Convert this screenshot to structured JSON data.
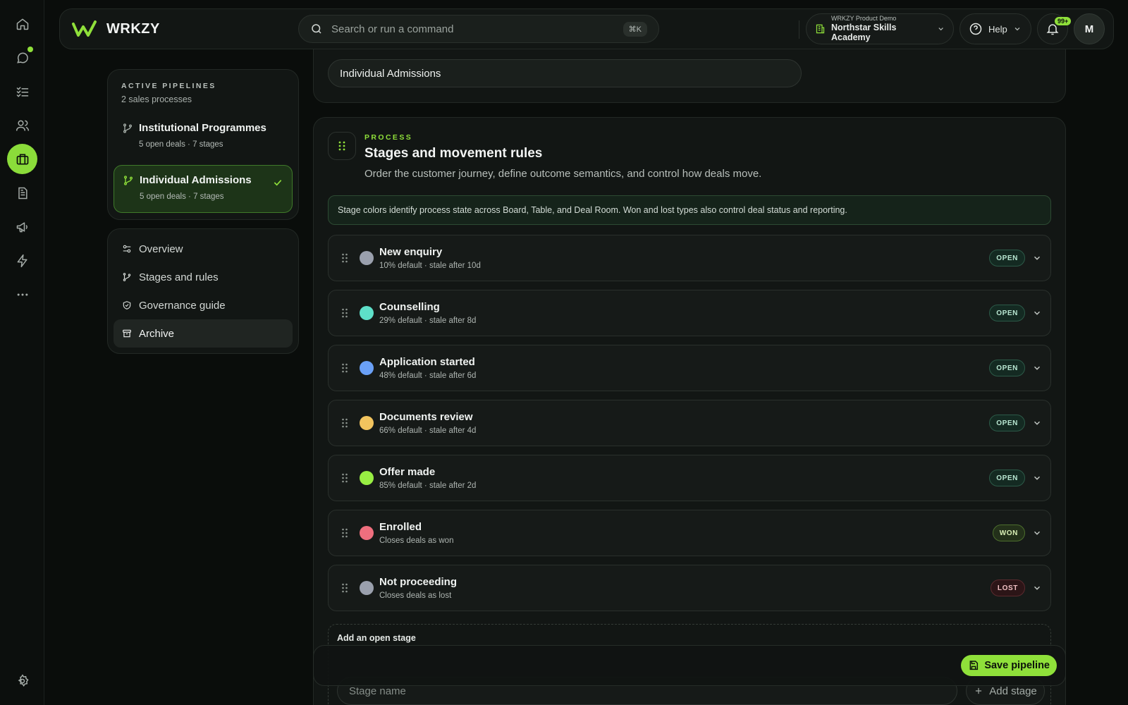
{
  "app": {
    "brand": "WRKZY"
  },
  "search": {
    "placeholder": "Search or run a command",
    "shortcut": "⌘K"
  },
  "org": {
    "caption": "WRKZY Product Demo",
    "name": "Northstar Skills Academy"
  },
  "help": {
    "label": "Help"
  },
  "notifications": {
    "count": "99+"
  },
  "user": {
    "initial": "M"
  },
  "rail": {
    "items": [
      {
        "icon": "home-icon"
      },
      {
        "icon": "chat-icon",
        "unread_dot": true
      },
      {
        "icon": "tasks-icon"
      },
      {
        "icon": "contacts-icon"
      },
      {
        "icon": "briefcase-icon",
        "active": true
      },
      {
        "icon": "document-icon"
      },
      {
        "icon": "megaphone-icon"
      },
      {
        "icon": "lightning-icon"
      },
      {
        "icon": "more-icon"
      }
    ],
    "settings_icon": "gear-icon"
  },
  "pipelines": {
    "eyebrow": "ACTIVE PIPELINES",
    "count_label": "2 sales processes",
    "items": [
      {
        "name": "Institutional Programmes",
        "meta": "5 open deals · 7 stages",
        "active": false
      },
      {
        "name": "Individual Admissions",
        "meta": "5 open deals · 7 stages",
        "active": true
      }
    ]
  },
  "nav": {
    "items": [
      {
        "label": "Overview",
        "icon": "sliders-icon"
      },
      {
        "label": "Stages and rules",
        "icon": "branch-icon"
      },
      {
        "label": "Governance guide",
        "icon": "shield-check-icon"
      },
      {
        "label": "Archive",
        "icon": "archive-icon",
        "active": true
      }
    ]
  },
  "pipeline_name": {
    "value": "Individual Admissions"
  },
  "process": {
    "eyebrow": "PROCESS",
    "title": "Stages and movement rules",
    "description": "Order the customer journey, define outcome semantics, and control how deals move.",
    "info": "Stage colors identify process state across Board, Table, and Deal Room. Won and lost types also control deal status and reporting.",
    "stages": [
      {
        "name": "New enquiry",
        "meta": "10% default · stale after 10d",
        "color": "#9aa0ad",
        "type": "OPEN"
      },
      {
        "name": "Counselling",
        "meta": "29% default · stale after 8d",
        "color": "#5ee0c9",
        "type": "OPEN"
      },
      {
        "name": "Application started",
        "meta": "48% default · stale after 6d",
        "color": "#6aa0f6",
        "type": "OPEN"
      },
      {
        "name": "Documents review",
        "meta": "66% default · stale after 4d",
        "color": "#f2c45e",
        "type": "OPEN"
      },
      {
        "name": "Offer made",
        "meta": "85% default · stale after 2d",
        "color": "#98ee43",
        "type": "OPEN"
      },
      {
        "name": "Enrolled",
        "meta": "Closes deals as won",
        "color": "#ef6f7e",
        "type": "WON"
      },
      {
        "name": "Not proceeding",
        "meta": "Closes deals as lost",
        "color": "#9aa0ad",
        "type": "LOST"
      }
    ],
    "add_stage": {
      "title": "Add an open stage",
      "placeholder": "Stage name",
      "button": "Add stage"
    }
  },
  "actions": {
    "save": "Save pipeline"
  },
  "colors": {
    "accent": "#8fe03a",
    "background": "#0a0d0b",
    "card": "#121614"
  }
}
